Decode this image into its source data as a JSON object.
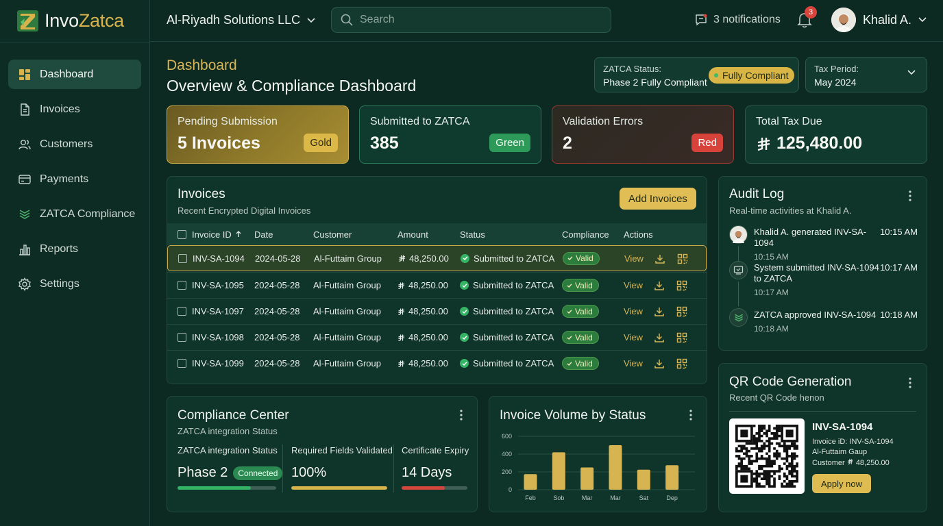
{
  "app": {
    "logo_part1": "Invo",
    "logo_part2": "Zatca"
  },
  "sidebar": {
    "items": [
      {
        "label": "Dashboard",
        "icon": "dashboard-icon",
        "active": true
      },
      {
        "label": "Invoices",
        "icon": "document-icon"
      },
      {
        "label": "Customers",
        "icon": "users-icon"
      },
      {
        "label": "Payments",
        "icon": "card-icon"
      },
      {
        "label": "ZATCA Compliance",
        "icon": "zatca-icon"
      },
      {
        "label": "Reports",
        "icon": "reports-icon"
      },
      {
        "label": "Settings",
        "icon": "gear-icon"
      }
    ]
  },
  "topbar": {
    "organization": "Al-Riyadh Solutions LLC",
    "search_placeholder": "Search",
    "notifications_label": "3 notifications",
    "bell_count": "3",
    "user_name": "Khalid A."
  },
  "header": {
    "breadcrumb": "Dashboard",
    "title": "Overview & Compliance Dashboard",
    "zatca_status_label": "ZATCA Status:",
    "zatca_status_value": "Phase 2 Fully Compliant",
    "zatca_status_pill": "Fully Compliant",
    "tax_period_label": "Tax Period:",
    "tax_period_value": "May 2024"
  },
  "stats": {
    "pending": {
      "label": "Pending Submission",
      "value": "5 Invoices",
      "badge": "Gold"
    },
    "submitted": {
      "label": "Submitted to ZATCA",
      "value": "385",
      "badge": "Green"
    },
    "errors": {
      "label": "Validation Errors",
      "value": "2",
      "badge": "Red"
    },
    "tax": {
      "label": "Total Tax Due",
      "value": "125,480.00"
    }
  },
  "invoices": {
    "title": "Invoices",
    "subtitle": "Recent Encrypted Digital Invoices",
    "add_button": "Add Invoices",
    "columns": [
      "Invoice ID",
      "Date",
      "Customer",
      "Amount",
      "Status",
      "Compliance",
      "Actions"
    ],
    "rows": [
      {
        "id": "INV-SA-1094",
        "date": "2024-05-28",
        "customer": "Al-Futtaim Group",
        "amount": "48,250.00",
        "status": "Submitted to ZATCA",
        "compliance": "Valid",
        "action": "View"
      },
      {
        "id": "INV-SA-1095",
        "date": "2024-05-28",
        "customer": "Al-Futtaim Group",
        "amount": "48,250.00",
        "status": "Submitted to ZATCA",
        "compliance": "Valid",
        "action": "View"
      },
      {
        "id": "INV-SA-1097",
        "date": "2024-05-28",
        "customer": "Al-Futtaim Group",
        "amount": "48,250.00",
        "status": "Submitted to ZATCA",
        "compliance": "Valid",
        "action": "View"
      },
      {
        "id": "INV-SA-1098",
        "date": "2024-05-28",
        "customer": "Al-Futtaim Group",
        "amount": "48,250.00",
        "status": "Submitted to ZATCA",
        "compliance": "Valid",
        "action": "View"
      },
      {
        "id": "INV-SA-1099",
        "date": "2024-05-28",
        "customer": "Al-Futtaim Group",
        "amount": "48,250.00",
        "status": "Submitted to ZATCA",
        "compliance": "Valid",
        "action": "View"
      }
    ]
  },
  "audit": {
    "title": "Audit Log",
    "subtitle": "Real-time activities at Khalid A.",
    "items": [
      {
        "text": "Khalid A. generated INV-SA-1094",
        "sub": "10:15 AM",
        "time": "10:15 AM"
      },
      {
        "text": "System submitted INV-SA-1094 to ZATCA",
        "sub": "10:17 AM",
        "time": "10:17 AM"
      },
      {
        "text": "ZATCA approved INV-SA-1094",
        "sub": "10:18 AM",
        "time": "10:18 AM"
      }
    ]
  },
  "compliance": {
    "title": "Compliance Center",
    "subtitle": "ZATCA integration Status",
    "integration": {
      "label": "ZATCA integration Status",
      "value": "Phase 2",
      "badge": "Connected",
      "progress": 0.74
    },
    "fields": {
      "label": "Required Fields Validated",
      "value": "100%",
      "progress": 1.0
    },
    "certificate": {
      "label": "Certificate Expiry",
      "value": "14 Days",
      "progress": 0.66
    }
  },
  "chart_card": {
    "title": "Invoice Volume by Status"
  },
  "chart_data": {
    "type": "bar",
    "categories": [
      "Feb",
      "Sob",
      "Mar",
      "Mar",
      "Sat",
      "Dep"
    ],
    "values": [
      175,
      420,
      250,
      500,
      225,
      275
    ],
    "ylim": [
      0,
      600
    ],
    "yticks": [
      "0",
      "200",
      "400",
      "600"
    ],
    "title": "Invoice Volume by Status"
  },
  "qr": {
    "title": "QR Code Generation",
    "subtitle": "Recent QR Code henon",
    "invoice": "INV-SA-1094",
    "line1": "Invoice iD: INV-SA-1094",
    "line2": "Al-Futtaim Gaup",
    "line3_prefix": "Customer",
    "line3_amount": "48,250.00",
    "button": "Apply now"
  },
  "colors": {
    "background": "#0c2a22",
    "accent_gold": "#d8b657",
    "success_green": "#36b465",
    "error_red": "#d7433a"
  }
}
